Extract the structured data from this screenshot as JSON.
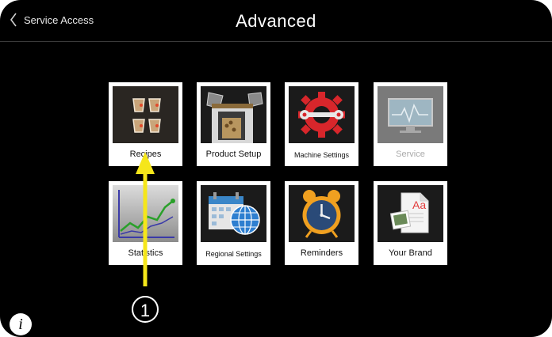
{
  "header": {
    "back_label": "Service Access",
    "title": "Advanced"
  },
  "tiles": [
    {
      "label": "Recipes",
      "icon": "recipes-icon",
      "enabled": true
    },
    {
      "label": "Product Setup",
      "icon": "product-setup-icon",
      "enabled": true
    },
    {
      "label": "Machine Settings",
      "icon": "machine-settings-gear-icon",
      "enabled": true
    },
    {
      "label": "Service",
      "icon": "service-monitor-icon",
      "enabled": false
    },
    {
      "label": "Statistics",
      "icon": "statistics-chart-icon",
      "enabled": true
    },
    {
      "label": "Regional Settings",
      "icon": "calendar-globe-icon",
      "enabled": true
    },
    {
      "label": "Reminders",
      "icon": "alarm-clock-icon",
      "enabled": true
    },
    {
      "label": "Your Brand",
      "icon": "brand-document-icon",
      "enabled": true
    }
  ],
  "annotation": {
    "callout": "1",
    "arrow_color": "#f5e61a"
  },
  "footer": {
    "info_icon": "i"
  },
  "colors": {
    "background": "#000000",
    "tile": "#ffffff",
    "disabled_text": "#aaaaaa",
    "gear": "#d8262b",
    "accent_yellow": "#f5e61a"
  }
}
